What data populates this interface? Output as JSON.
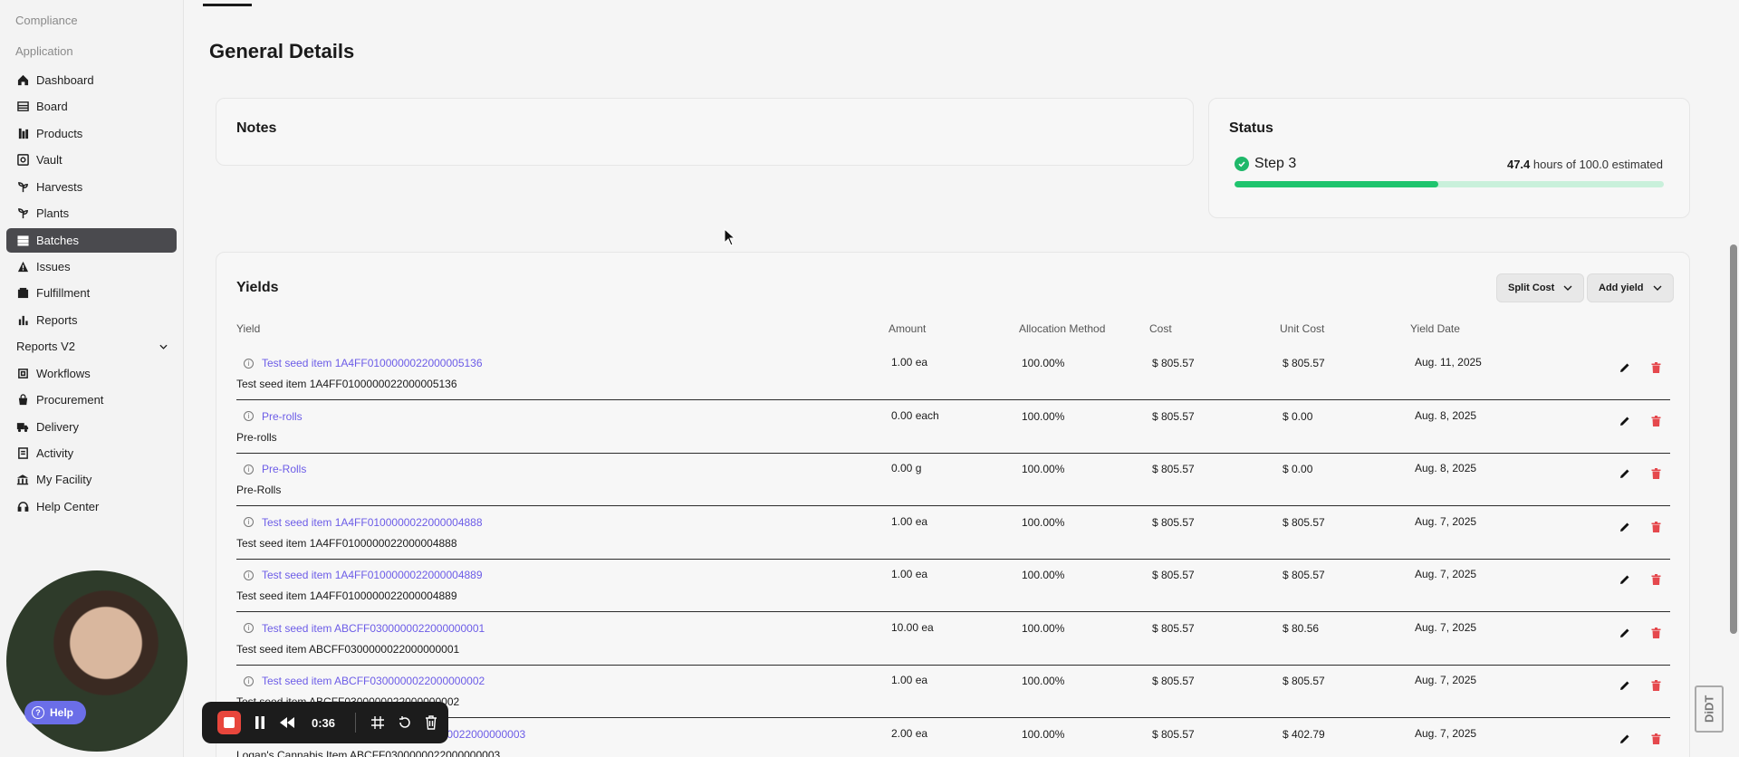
{
  "sidebar": {
    "section_compliance": "Compliance",
    "section_application": "Application",
    "items": [
      {
        "label": "Dashboard",
        "icon": "home-icon"
      },
      {
        "label": "Board",
        "icon": "board-icon"
      },
      {
        "label": "Products",
        "icon": "products-icon"
      },
      {
        "label": "Vault",
        "icon": "vault-icon"
      },
      {
        "label": "Harvests",
        "icon": "harvests-icon"
      },
      {
        "label": "Plants",
        "icon": "plants-icon"
      },
      {
        "label": "Batches",
        "icon": "batches-icon",
        "active": true
      },
      {
        "label": "Issues",
        "icon": "warning-icon"
      },
      {
        "label": "Fulfillment",
        "icon": "fulfillment-icon"
      },
      {
        "label": "Reports",
        "icon": "bar-chart-icon"
      },
      {
        "label": "Reports V2",
        "icon": "chevron-down-icon"
      },
      {
        "label": "Workflows",
        "icon": "workflows-icon"
      },
      {
        "label": "Procurement",
        "icon": "procurement-icon"
      },
      {
        "label": "Delivery",
        "icon": "truck-icon"
      },
      {
        "label": "Activity",
        "icon": "activity-icon"
      },
      {
        "label": "My Facility",
        "icon": "facility-icon"
      },
      {
        "label": "Help Center",
        "icon": "headset-icon"
      }
    ]
  },
  "page": {
    "title": "General Details"
  },
  "notes": {
    "title": "Notes"
  },
  "status": {
    "title": "Status",
    "step": "Step 3",
    "hours_done": "47.4",
    "hours_text": "hours of 100.0 estimated",
    "progress_fraction": 0.474,
    "accent": "#1fc46e"
  },
  "yields": {
    "title": "Yields",
    "split_cost_label": "Split Cost",
    "add_yield_label": "Add yield",
    "columns": [
      "Yield",
      "Amount",
      "Allocation Method",
      "Cost",
      "Unit Cost",
      "Yield Date"
    ],
    "rows": [
      {
        "link": "Test seed item 1A4FF0100000022000005136",
        "sub": "Test seed item 1A4FF0100000022000005136",
        "amount": "1.00 ea",
        "allocation": "100.00%",
        "cost": "$ 805.57",
        "unit_cost": "$ 805.57",
        "date": "Aug. 11, 2025"
      },
      {
        "link": "Pre-rolls",
        "sub": "Pre-rolls",
        "amount": "0.00 each",
        "allocation": "100.00%",
        "cost": "$ 805.57",
        "unit_cost": "$ 0.00",
        "date": "Aug. 8, 2025"
      },
      {
        "link": "Pre-Rolls",
        "sub": "Pre-Rolls",
        "amount": "0.00 g",
        "allocation": "100.00%",
        "cost": "$ 805.57",
        "unit_cost": "$ 0.00",
        "date": "Aug. 8, 2025"
      },
      {
        "link": "Test seed item 1A4FF0100000022000004888",
        "sub": "Test seed item 1A4FF0100000022000004888",
        "amount": "1.00 ea",
        "allocation": "100.00%",
        "cost": "$ 805.57",
        "unit_cost": "$ 805.57",
        "date": "Aug. 7, 2025"
      },
      {
        "link": "Test seed item 1A4FF0100000022000004889",
        "sub": "Test seed item 1A4FF0100000022000004889",
        "amount": "1.00 ea",
        "allocation": "100.00%",
        "cost": "$ 805.57",
        "unit_cost": "$ 805.57",
        "date": "Aug. 7, 2025"
      },
      {
        "link": "Test seed item ABCFF0300000022000000001",
        "sub": "Test seed item ABCFF0300000022000000001",
        "amount": "10.00 ea",
        "allocation": "100.00%",
        "cost": "$ 805.57",
        "unit_cost": "$ 80.56",
        "date": "Aug. 7, 2025"
      },
      {
        "link": "Test seed item ABCFF0300000022000000002",
        "sub": "Test seed item ABCFF0300000022000000002",
        "amount": "1.00 ea",
        "allocation": "100.00%",
        "cost": "$ 805.57",
        "unit_cost": "$ 805.57",
        "date": "Aug. 7, 2025"
      },
      {
        "link": "Logan's Cannabis Item ABCFF0300000022000000003",
        "sub": "Logan's Cannabis Item ABCFF0300000022000000003",
        "amount": "2.00 ea",
        "allocation": "100.00%",
        "cost": "$ 805.57",
        "unit_cost": "$ 402.79",
        "date": "Aug. 7, 2025"
      }
    ]
  },
  "overlay": {
    "help_label": "Help",
    "recording_time": "0:36",
    "watermark": "DiDT"
  }
}
